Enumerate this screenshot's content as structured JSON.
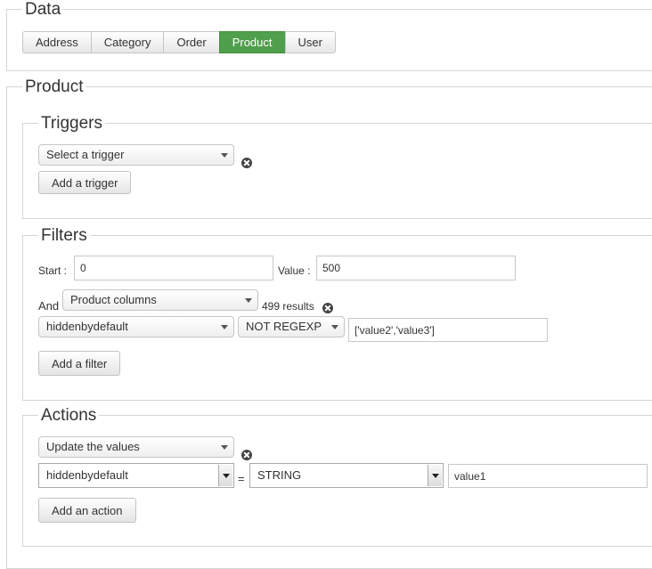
{
  "data_section": {
    "legend": "Data",
    "tabs": [
      {
        "label": "Address",
        "active": false
      },
      {
        "label": "Category",
        "active": false
      },
      {
        "label": "Order",
        "active": false
      },
      {
        "label": "Product",
        "active": true
      },
      {
        "label": "User",
        "active": false
      }
    ]
  },
  "product_section": {
    "legend": "Product",
    "triggers": {
      "legend": "Triggers",
      "select_value": "Select a trigger",
      "add_button": "Add a trigger"
    },
    "filters": {
      "legend": "Filters",
      "start_label": "Start :",
      "start_value": "0",
      "value_label": "Value :",
      "value_value": "500",
      "and_label": "And",
      "columns_select": "Product columns",
      "results_text": "499 results",
      "field_select": "hiddenbydefault",
      "operator_select": "NOT REGEXP",
      "filter_value": "['value2','value3']",
      "add_button": "Add a filter"
    },
    "actions": {
      "legend": "Actions",
      "action_select": "Update the values",
      "field_select": "hiddenbydefault",
      "equals": "=",
      "type_select": "STRING",
      "value": "value1",
      "add_button": "Add an action"
    }
  },
  "colors": {
    "active_tab": "#4f9f4c",
    "border": "#d5d5d5"
  }
}
